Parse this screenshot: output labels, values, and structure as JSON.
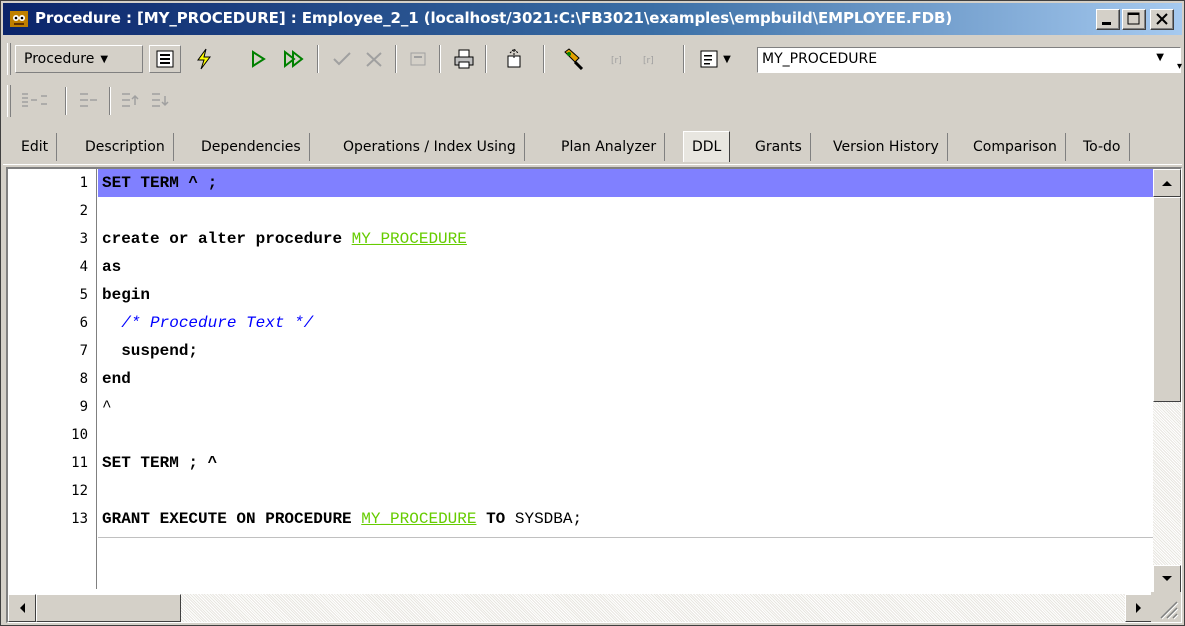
{
  "window": {
    "title": "Procedure : [MY_PROCEDURE] : Employee_2_1 (localhost/3021:C:\\FB3021\\examples\\empbuild\\EMPLOYEE.FDB)"
  },
  "toolbar": {
    "object_type_label": "Procedure",
    "object_name_value": "MY_PROCEDURE",
    "icons": [
      "form-icon",
      "compile-icon",
      "run-icon",
      "step-run-icon",
      "commit-icon",
      "rollback-icon",
      "memo-icon",
      "print-icon",
      "export-icon",
      "settings-icon",
      "param-icon",
      "param2-icon",
      "view-menu-icon"
    ]
  },
  "tabs": [
    {
      "label": "Edit"
    },
    {
      "label": "Description"
    },
    {
      "label": "Dependencies"
    },
    {
      "label": "Operations / Index Using"
    },
    {
      "label": "Plan Analyzer"
    },
    {
      "label": "DDL"
    },
    {
      "label": "Grants"
    },
    {
      "label": "Version History"
    },
    {
      "label": "Comparison"
    },
    {
      "label": "To-do"
    }
  ],
  "active_tab": "DDL",
  "editor": {
    "line_numbers": [
      "1",
      "2",
      "3",
      "4",
      "5",
      "6",
      "7",
      "8",
      "9",
      "10",
      "11",
      "12",
      "13"
    ],
    "lines": {
      "l1": "SET TERM ^ ;",
      "l3_kw": "create or alter procedure ",
      "l3_id": "MY_PROCEDURE",
      "l4": "as",
      "l5": "begin",
      "l6": "  /* Procedure Text */",
      "l7": "  suspend;",
      "l8": "end",
      "l9": "^",
      "l11": "SET TERM ; ^",
      "l13_kw1": "GRANT EXECUTE ON PROCEDURE ",
      "l13_id": "MY_PROCEDURE",
      "l13_kw2": " TO ",
      "l13_tail": "SYSDBA;"
    }
  },
  "colors": {
    "selection": "#8080ff",
    "identifier": "#66cc00",
    "comment": "#0000ff",
    "titlebar": "#0a246a"
  }
}
